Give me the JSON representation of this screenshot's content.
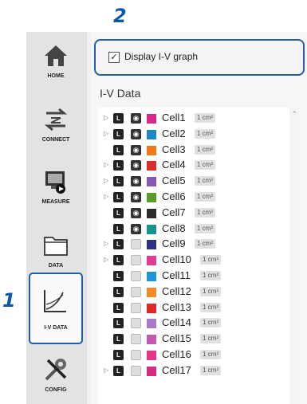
{
  "annotations": {
    "step1": "1",
    "step2": "2"
  },
  "sidebar": {
    "items": [
      {
        "label": "HOME",
        "icon": "home-icon"
      },
      {
        "label": "CONNECT",
        "icon": "connect-icon"
      },
      {
        "label": "MEASURE",
        "icon": "measure-icon"
      },
      {
        "label": "DATA",
        "icon": "folder-icon"
      },
      {
        "label": "I-V DATA",
        "icon": "iv-graph-icon",
        "active": true
      },
      {
        "label": "CONFIG",
        "icon": "tools-icon"
      }
    ]
  },
  "display_option": {
    "label": "Display I-V graph",
    "checked": true,
    "check_glyph": "✓"
  },
  "section": {
    "title": "I-V Data"
  },
  "cells": [
    {
      "name": "Cell1",
      "area": "1 cm²",
      "color": "#d62a8a",
      "visible": true,
      "expandable": true
    },
    {
      "name": "Cell2",
      "area": "1 cm²",
      "color": "#1f86c8",
      "visible": true,
      "expandable": true
    },
    {
      "name": "Cell3",
      "area": "1 cm²",
      "color": "#f07a1a",
      "visible": true,
      "expandable": false
    },
    {
      "name": "Cell4",
      "area": "1 cm²",
      "color": "#d92c2c",
      "visible": true,
      "expandable": true
    },
    {
      "name": "Cell5",
      "area": "1 cm²",
      "color": "#8b57b5",
      "visible": true,
      "expandable": true
    },
    {
      "name": "Cell6",
      "area": "1 cm²",
      "color": "#5a9a2a",
      "visible": true,
      "expandable": true
    },
    {
      "name": "Cell7",
      "area": "1 cm²",
      "color": "#2a2a2a",
      "visible": true,
      "expandable": false
    },
    {
      "name": "Cell8",
      "area": "1 cm²",
      "color": "#16968a",
      "visible": true,
      "expandable": false
    },
    {
      "name": "Cell9",
      "area": "1 cm²",
      "color": "#2b3480",
      "visible": false,
      "expandable": true
    },
    {
      "name": "Cell10",
      "area": "1 cm²",
      "color": "#e23b95",
      "visible": false,
      "expandable": true
    },
    {
      "name": "Cell11",
      "area": "1 cm²",
      "color": "#1f94d6",
      "visible": false,
      "expandable": false
    },
    {
      "name": "Cell12",
      "area": "1 cm²",
      "color": "#f28a2a",
      "visible": false,
      "expandable": false
    },
    {
      "name": "Cell13",
      "area": "1 cm²",
      "color": "#e02828",
      "visible": false,
      "expandable": false
    },
    {
      "name": "Cell14",
      "area": "1 cm²",
      "color": "#a87ac8",
      "visible": false,
      "expandable": false
    },
    {
      "name": "Cell15",
      "area": "1 cm²",
      "color": "#c25ab0",
      "visible": false,
      "expandable": false
    },
    {
      "name": "Cell16",
      "area": "1 cm²",
      "color": "#e6368c",
      "visible": false,
      "expandable": false
    },
    {
      "name": "Cell17",
      "area": "1 cm²",
      "color": "#d42a82",
      "visible": false,
      "expandable": true
    }
  ],
  "glyphs": {
    "expander": "▷",
    "lock": "L",
    "eye": "◉",
    "scroll_up": "⌃"
  },
  "colors": {
    "accent": "#1d5fa8",
    "annotation": "#0a58a8"
  }
}
